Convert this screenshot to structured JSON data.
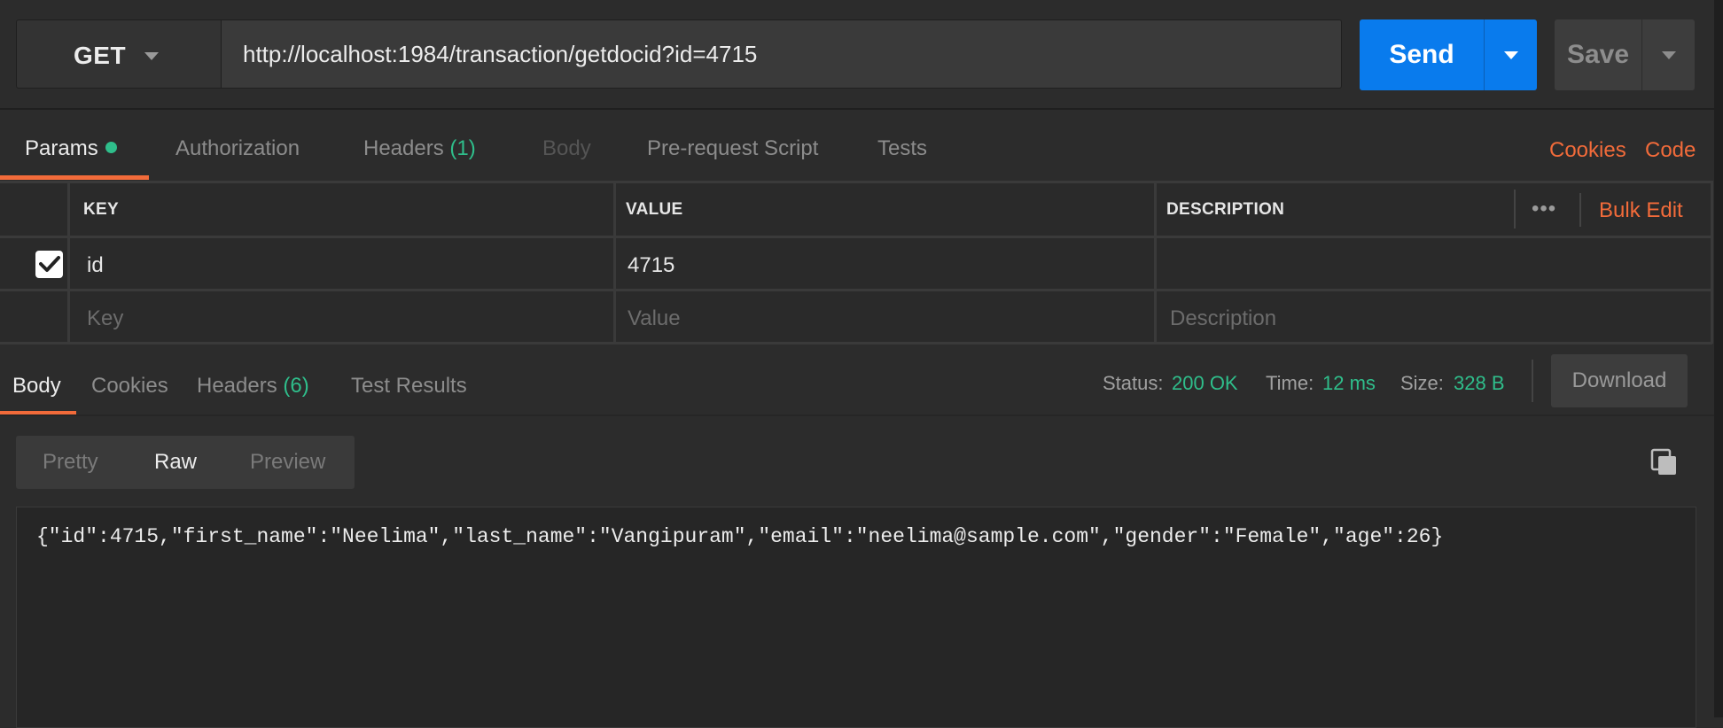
{
  "request": {
    "method": "GET",
    "url": "http://localhost:1984/transaction/getdocid?id=4715",
    "send_label": "Send",
    "save_label": "Save"
  },
  "request_tabs": {
    "params": "Params",
    "authorization": "Authorization",
    "headers": "Headers",
    "headers_count": "(1)",
    "body": "Body",
    "prerequest": "Pre-request Script",
    "tests": "Tests",
    "cookies_link": "Cookies",
    "code_link": "Code"
  },
  "params_table": {
    "headers": {
      "key": "KEY",
      "value": "VALUE",
      "description": "DESCRIPTION"
    },
    "more_icon": "more-horizontal-icon",
    "bulk_edit": "Bulk Edit",
    "rows": [
      {
        "checked": true,
        "key": "id",
        "value": "4715",
        "description": ""
      }
    ],
    "placeholders": {
      "key": "Key",
      "value": "Value",
      "description": "Description"
    }
  },
  "response_tabs": {
    "body": "Body",
    "cookies": "Cookies",
    "headers": "Headers",
    "headers_count": "(6)",
    "test_results": "Test Results"
  },
  "response_status": {
    "status_label": "Status:",
    "status_value": "200 OK",
    "time_label": "Time:",
    "time_value": "12 ms",
    "size_label": "Size:",
    "size_value": "328 B",
    "download_label": "Download"
  },
  "view_modes": {
    "pretty": "Pretty",
    "raw": "Raw",
    "preview": "Preview"
  },
  "response_body": "{\"id\":4715,\"first_name\":\"Neelima\",\"last_name\":\"Vangipuram\",\"email\":\"neelima@sample.com\",\"gender\":\"Female\",\"age\":26}",
  "colors": {
    "accent_blue": "#097bed",
    "accent_orange": "#f26b3a",
    "success_green": "#2fbe8b",
    "background": "#2c2c2c"
  }
}
